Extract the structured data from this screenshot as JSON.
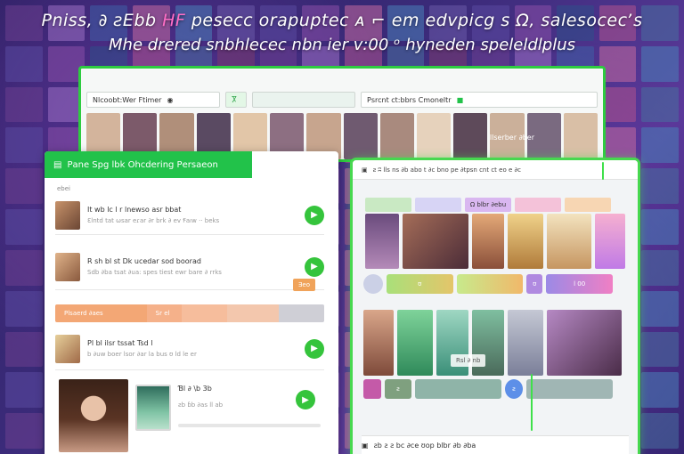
{
  "headline": {
    "line1_start": "Pniss, ∂ ƨEbb",
    "line1_highlight": "ΗF",
    "line1_end": "pesecc orapuptec ᴀ ⌐ em edvpicg s Ω, salesocecʼs",
    "line2": "Мhe drered snbhlecec nbn ier v:00 ᵒ hyneden speleldlplus"
  },
  "back_window": {
    "left_field": "Nlcoobt:Wer Ftimer",
    "tab_icon_label": "Ⴟ",
    "right_field": "Рsrcnt ct:bbrs Cmoneltr",
    "strip_label": "llserber ∂ber"
  },
  "left_panel": {
    "header_title": "Рane Spg  lbk Ohcdering  Рersaeon",
    "sub": "ebei",
    "items": [
      {
        "title": "It wb lc l r lnewso asr bbat",
        "meta": "Ɛlntd  tat ωsar  eɾar  ∂r brk  ∂ ev  Ꞙaıw  ··  beks"
      },
      {
        "title": "R sh bl st  Dk ucedar sod boorad",
        "meta": "Sdb  ∂ba  tsat  ∂ua: spes  tiest  ewr  bare  ∂  rrks"
      },
      {
        "title": "Pl bl ilsr tssat Tsd l",
        "meta": "b  ∂uw  boer  lsor  ∂ar  la  bus  ʊ  ld  le  er"
      },
      {
        "title": "Ɓl  ∂ \\b 3b",
        "meta": "ƨb  ɓb  ∂as  ll  ab"
      }
    ],
    "orange_tag": "Ǝeo",
    "progress_labels": [
      "Plsaerd  ∂aes",
      "Sr el",
      "",
      "",
      ""
    ]
  },
  "right_panel": {
    "top_text": "ƨ  ʭ lls ns ∂b  abo  t ∂c  bno  pe  ∂tpsn  cnt  ct  eo  e  ∂c",
    "tab_labels": [
      "",
      "",
      "Ω blbr  ∂ebu",
      "",
      ""
    ],
    "chip": "Rsl  ∂ nb",
    "bar_labels": [
      "",
      "ʊ",
      "",
      "ʊ",
      "l 00",
      "",
      "ƨ",
      "",
      "ƨ",
      ""
    ],
    "footer_text": "ƨb  ƨ ƨ bc  ∂ce ʊop blbr  ∂b ∂ba"
  },
  "colors": {
    "accent_green": "#22c24a",
    "glow_green": "#47d84f",
    "orange": "#f0a35a",
    "background_purple": "#3b2b7a"
  },
  "icons": {
    "play": "play-icon",
    "browser": "browser-icon",
    "menu": "menu-icon"
  }
}
